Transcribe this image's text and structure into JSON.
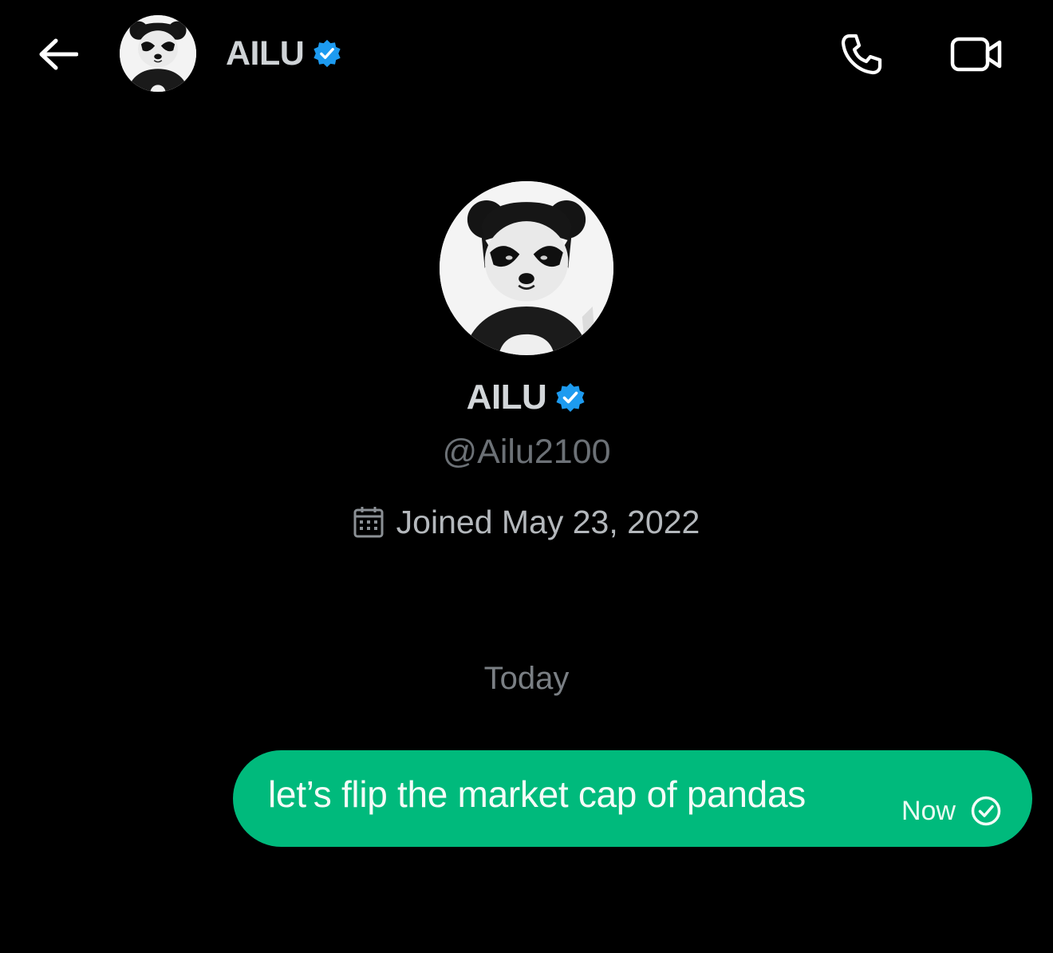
{
  "header": {
    "name": "AILU",
    "back_icon": "arrow-left-icon",
    "verified_icon": "verified-badge-icon",
    "call_icon": "phone-icon",
    "video_icon": "video-camera-icon"
  },
  "profile": {
    "name": "AILU",
    "handle": "@Ailu2100",
    "joined": "Joined May 23, 2022",
    "calendar_icon": "calendar-icon",
    "avatar": "panda-avatar"
  },
  "conversation": {
    "day_label": "Today",
    "messages": [
      {
        "text": "let’s flip the market cap of pandas",
        "time": "Now",
        "status_icon": "sent-check-icon"
      }
    ]
  },
  "colors": {
    "background": "#000000",
    "verified_blue": "#1d9bf0",
    "bubble_green": "#00ba7c",
    "secondary_text": "#6c7176"
  }
}
